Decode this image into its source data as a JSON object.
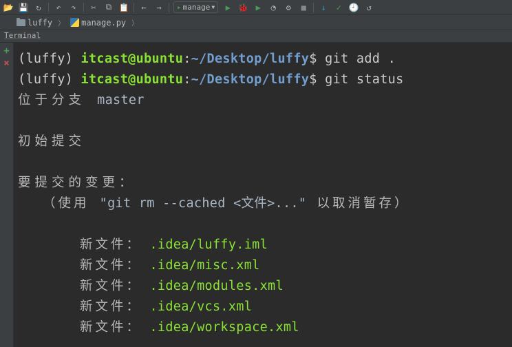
{
  "toolbar": {
    "run_config": "manage"
  },
  "tabs": {
    "project": "luffy",
    "file": "manage.py"
  },
  "panel": {
    "title": "Terminal"
  },
  "prompt": {
    "env": "(luffy) ",
    "userhost": "itcast@ubuntu",
    "sep": ":",
    "path": "~/Desktop/luffy",
    "dollar": "$ "
  },
  "cmd": {
    "add": "git add .",
    "status": "git status"
  },
  "status": {
    "branch_label": "位于分支 ",
    "branch": "master",
    "initial_commit": "初始提交",
    "changes_header": "要提交的变更：",
    "unstage_pre": "（使用 ",
    "unstage_cmd": "\"git rm --cached <文件>...\"",
    "unstage_post": " 以取消暂存）"
  },
  "files": {
    "label": "新文件：",
    "gap": "   ",
    "items": [
      ".idea/luffy.iml",
      ".idea/misc.xml",
      ".idea/modules.xml",
      ".idea/vcs.xml",
      ".idea/workspace.xml"
    ]
  }
}
